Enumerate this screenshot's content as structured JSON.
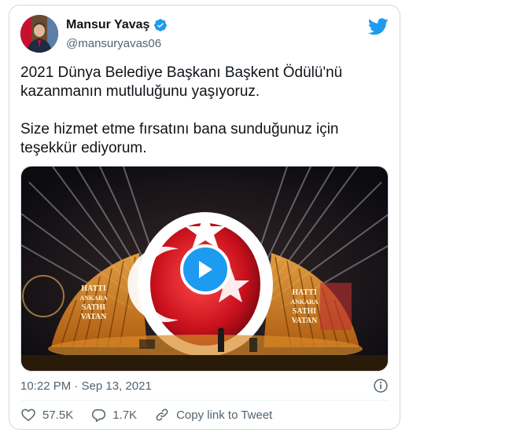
{
  "tweet": {
    "author_name": "Mansur Yavaş",
    "handle": "@mansuryavas06",
    "paragraphs": [
      "2021 Dünya Belediye Başkanı Başkent Ödülü'nü kazanmanın mutluluğunu yaşıyoruz.",
      "Size hizmet etme fırsatını bana sunduğunuz için teşekkür ediyorum."
    ],
    "timestamp": "10:22 PM · Sep 13, 2021",
    "likes": "57.5K",
    "replies": "1.7K",
    "copy_link_label": "Copy link to Tweet"
  },
  "media": {
    "banner_left": [
      "HATTI",
      "ANKARA",
      "SATHI",
      "VATAN"
    ],
    "banner_right": [
      "HATTI",
      "ANKARA",
      "SATHI",
      "VATAN"
    ]
  },
  "colors": {
    "accent": "#1d9bf0",
    "text": "#0f1419",
    "muted": "#536471",
    "border": "#cfd9de",
    "flag_red": "#d91e28"
  },
  "icons": [
    "verified-badge-icon",
    "twitter-bird-icon",
    "play-icon",
    "info-icon",
    "heart-icon",
    "reply-icon",
    "link-icon"
  ]
}
